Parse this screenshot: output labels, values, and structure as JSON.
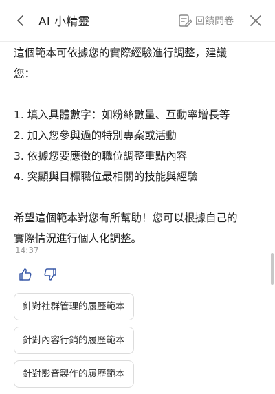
{
  "header": {
    "title": "AI 小精靈",
    "feedback_label": "回饋問卷"
  },
  "message": {
    "intro_line1": "這個範本可依據您的實際經驗進行調整，建議",
    "intro_line2": "您：",
    "items": [
      "1. 填入具體數字：如粉絲數量、互動率增長等",
      "2. 加入您參與過的特別專案或活動",
      "3. 依據您要應徵的職位調整重點內容",
      "4. 突顯與目標職位最相關的技能與經驗"
    ],
    "closing_line1": "希望這個範本對您有所幫助！您可以根據自己的",
    "closing_line2": "實際情況進行個人化調整。",
    "timestamp": "14:37"
  },
  "suggestions": [
    "針對社群管理的履歷範本",
    "針對內容行銷的履歷範本",
    "針對影音製作的履歷範本"
  ],
  "colors": {
    "icon_gray": "#8a8a8a",
    "action_icon": "#3a5aa8",
    "border": "#dcdcdc"
  },
  "icons": [
    "chevron-left-icon",
    "feedback-form-icon",
    "close-icon",
    "thumbs-up-icon",
    "thumbs-down-icon"
  ]
}
